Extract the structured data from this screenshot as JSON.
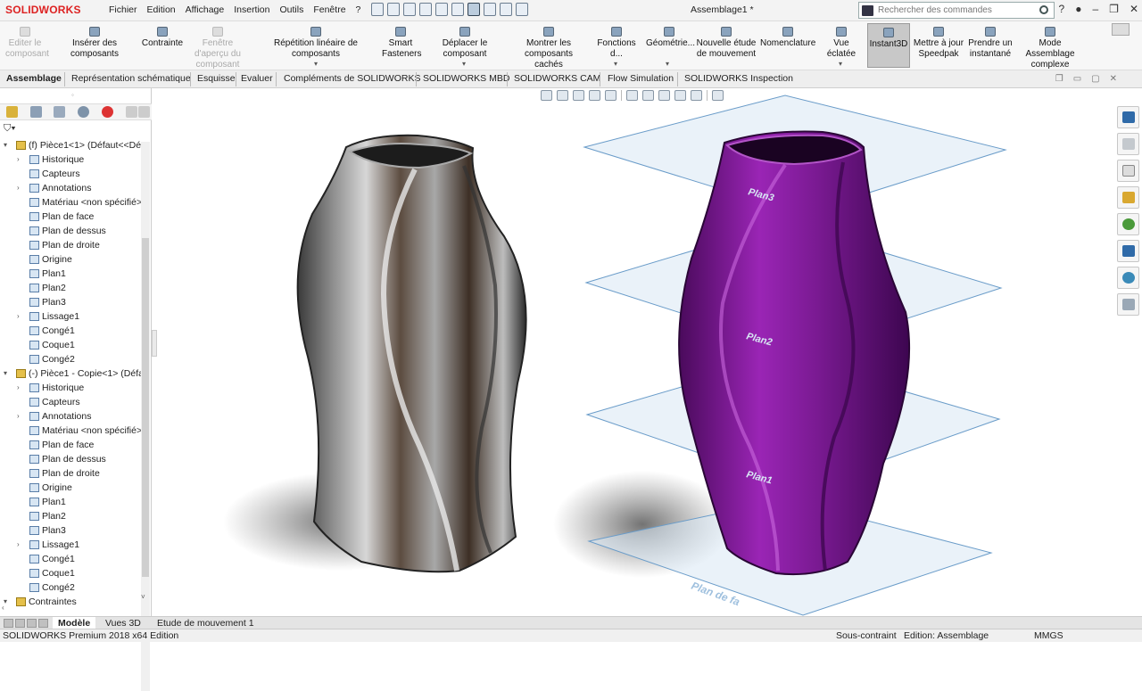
{
  "app": {
    "logo": "SOLIDWORKS",
    "title": "Assemblage1 *"
  },
  "menu": [
    "Fichier",
    "Edition",
    "Affichage",
    "Insertion",
    "Outils",
    "Fenêtre",
    "?"
  ],
  "search": {
    "placeholder": "Rechercher des commandes"
  },
  "ribbon": [
    {
      "label": "Editer le composant",
      "disabled": true
    },
    {
      "label": "Insérer des composants"
    },
    {
      "label": "Contrainte"
    },
    {
      "label": "Fenêtre d'aperçu du composant",
      "disabled": true
    },
    {
      "label": "Répétition linéaire de composants"
    },
    {
      "label": "Smart Fasteners"
    },
    {
      "label": "Déplacer le composant"
    },
    {
      "label": "Montrer les composants cachés"
    },
    {
      "label": "Fonctions d..."
    },
    {
      "label": "Géométrie..."
    },
    {
      "label": "Nouvelle étude de mouvement"
    },
    {
      "label": "Nomenclature"
    },
    {
      "label": "Vue éclatée"
    },
    {
      "label": "Instant3D",
      "active": true
    },
    {
      "label": "Mettre à jour Speedpak"
    },
    {
      "label": "Prendre un instantané"
    },
    {
      "label": "Mode Assemblage complexe"
    }
  ],
  "tabs": [
    "Assemblage",
    "Représentation schématique",
    "Esquisse",
    "Evaluer",
    "Compléments de SOLIDWORKS",
    "SOLIDWORKS MBD",
    "SOLIDWORKS CAM",
    "Flow Simulation",
    "SOLIDWORKS Inspection"
  ],
  "tree": [
    {
      "label": "(f) Pièce1<1> (Défaut<<Déf",
      "level": 0
    },
    {
      "label": "Historique",
      "level": 1,
      "expand": true
    },
    {
      "label": "Capteurs",
      "level": 1
    },
    {
      "label": "Annotations",
      "level": 1,
      "expand": true
    },
    {
      "label": "Matériau <non spécifié>",
      "level": 1
    },
    {
      "label": "Plan de face",
      "level": 1
    },
    {
      "label": "Plan de dessus",
      "level": 1
    },
    {
      "label": "Plan de droite",
      "level": 1
    },
    {
      "label": "Origine",
      "level": 1
    },
    {
      "label": "Plan1",
      "level": 1
    },
    {
      "label": "Plan2",
      "level": 1
    },
    {
      "label": "Plan3",
      "level": 1
    },
    {
      "label": "Lissage1",
      "level": 1,
      "expand": true
    },
    {
      "label": "Congé1",
      "level": 1
    },
    {
      "label": "Coque1",
      "level": 1
    },
    {
      "label": "Congé2",
      "level": 1
    },
    {
      "label": "(-) Pièce1 - Copie<1> (Défa",
      "level": 0
    },
    {
      "label": "Historique",
      "level": 1,
      "expand": true
    },
    {
      "label": "Capteurs",
      "level": 1
    },
    {
      "label": "Annotations",
      "level": 1,
      "expand": true
    },
    {
      "label": "Matériau <non spécifié>",
      "level": 1
    },
    {
      "label": "Plan de face",
      "level": 1
    },
    {
      "label": "Plan de dessus",
      "level": 1
    },
    {
      "label": "Plan de droite",
      "level": 1
    },
    {
      "label": "Origine",
      "level": 1
    },
    {
      "label": "Plan1",
      "level": 1
    },
    {
      "label": "Plan2",
      "level": 1
    },
    {
      "label": "Plan3",
      "level": 1
    },
    {
      "label": "Lissage1",
      "level": 1,
      "expand": true
    },
    {
      "label": "Congé1",
      "level": 1
    },
    {
      "label": "Coque1",
      "level": 1
    },
    {
      "label": "Congé2",
      "level": 1
    },
    {
      "label": "Contraintes",
      "level": 0
    }
  ],
  "planes": {
    "plan3": "Plan3",
    "plan2": "Plan2",
    "plan1": "Plan1",
    "base": "Plan de fa"
  },
  "bottom_tabs": [
    "Modèle",
    "Vues 3D",
    "Etude de mouvement 1"
  ],
  "status": {
    "version": "SOLIDWORKS Premium 2018 x64 Edition",
    "state": "Sous-contraint",
    "mode": "Edition: Assemblage",
    "units": "MMGS"
  },
  "colors": {
    "accent": "#d22121",
    "purple": "#8b1fa3",
    "plane": "#d8e8f4"
  }
}
